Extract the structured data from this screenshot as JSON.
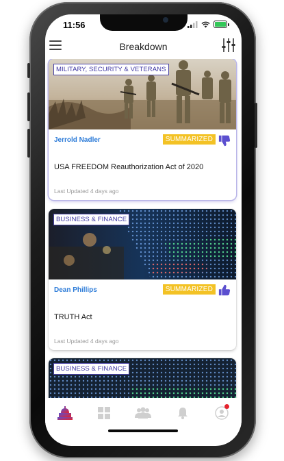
{
  "status_bar": {
    "time": "11:56"
  },
  "header": {
    "title": "Breakdown"
  },
  "cards": [
    {
      "category": "MILITARY, SECURITY & VETERANS",
      "author": "Jerrold Nadler",
      "badge": "SUMMARIZED",
      "vote": "thumbs-down",
      "title": "USA FREEDOM Reauthorization Act of 2020",
      "updated": "Last Updated 4 days ago"
    },
    {
      "category": "BUSINESS & FINANCE",
      "author": "Dean Phillips",
      "badge": "SUMMARIZED",
      "vote": "thumbs-up",
      "title": "TRUTH Act",
      "updated": "Last Updated 4 days ago"
    },
    {
      "category": "BUSINESS & FINANCE"
    }
  ],
  "tabbar": {
    "items": [
      "capitol-icon",
      "grid-icon",
      "people-icon",
      "bell-icon",
      "profile-icon"
    ],
    "active_index": 0
  },
  "colors": {
    "accent_purple": "#3e36a3",
    "author_blue": "#2c7bd8",
    "badge_yellow": "#f3c225",
    "vote_purple": "#5b4fcf",
    "notification_red": "#e5232e"
  }
}
